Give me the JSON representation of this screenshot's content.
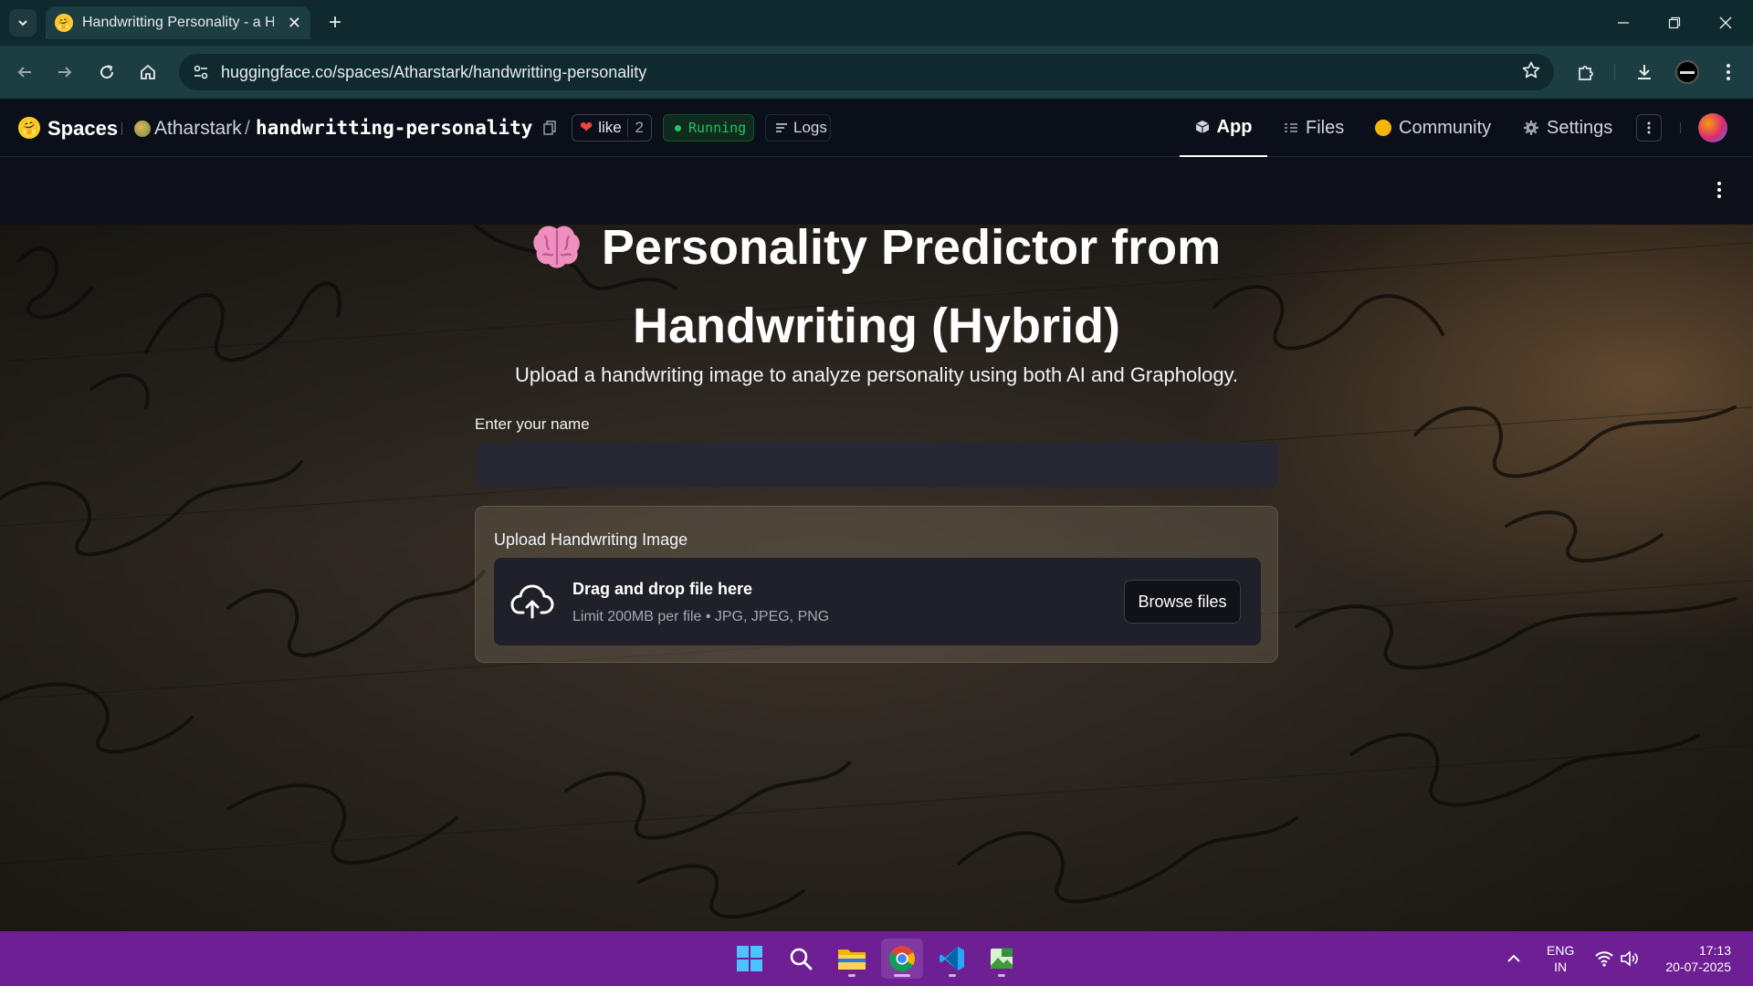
{
  "browser": {
    "tab_title": "Handwritting Personality - a Hu",
    "url": "huggingface.co/spaces/Atharstark/handwritting-personality"
  },
  "hf": {
    "brand": "Spaces",
    "owner": "Atharstark",
    "separator": "/",
    "repo": "handwritting-personality",
    "like_label": "like",
    "like_count": "2",
    "status": "Running",
    "logs": "Logs",
    "nav": {
      "app": "App",
      "files": "Files",
      "community": "Community",
      "settings": "Settings"
    }
  },
  "app": {
    "title_line1": "Personality Predictor from",
    "title_line2": "Handwriting (Hybrid)",
    "subtitle": "Upload a handwriting image to analyze personality using both AI and Graphology.",
    "name_label": "Enter your name",
    "name_value": "",
    "upload_label": "Upload Handwriting Image",
    "drop_title": "Drag and drop file here",
    "drop_limit": "Limit 200MB per file • JPG, JPEG, PNG",
    "browse_label": "Browse files"
  },
  "taskbar": {
    "language": "ENG",
    "region": "IN",
    "time": "17:13",
    "date": "20-07-2025"
  },
  "colors": {
    "hf_bg": "#0b0f19",
    "running_green": "#22c55e",
    "taskbar": "#6d1f93",
    "input_bg": "#262730"
  }
}
